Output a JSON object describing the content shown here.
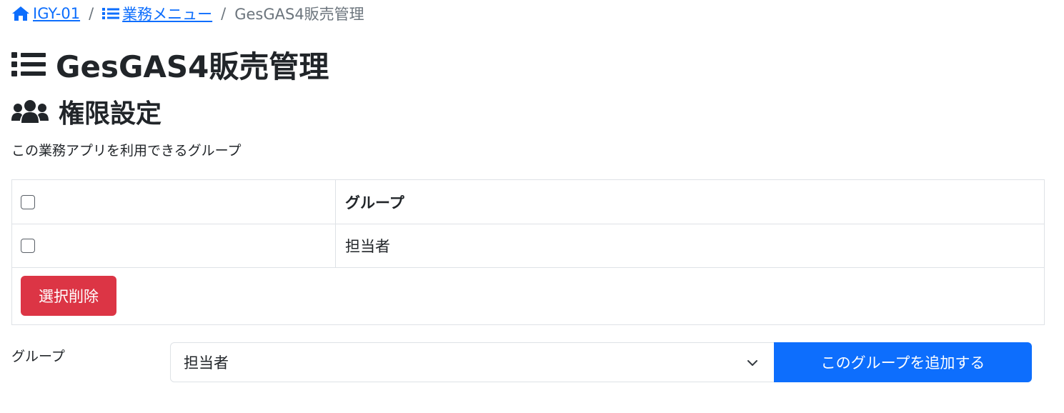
{
  "breadcrumb": {
    "home_label": "IGY-01",
    "menu_label": "業務メニュー",
    "current_label": "GesGAS4販売管理",
    "separator": "/"
  },
  "page_title": "GesGAS4販売管理",
  "section_title": "権限設定",
  "description": "この業務アプリを利用できるグループ",
  "table": {
    "header_label": "グループ",
    "rows": [
      {
        "group": "担当者"
      }
    ],
    "delete_button_label": "選択削除"
  },
  "add_form": {
    "label": "グループ",
    "selected_value": "担当者",
    "add_button_label": "このグループを追加する"
  },
  "colors": {
    "primary": "#0d6efd",
    "danger": "#dc3545",
    "muted": "#6c757d",
    "border": "#dee2e6",
    "text": "#212529"
  },
  "icons": {
    "home": "home-icon",
    "menu_list": "list-icon",
    "title_list": "list-icon",
    "section_users": "users-icon",
    "select_chevron": "chevron-down-icon"
  }
}
